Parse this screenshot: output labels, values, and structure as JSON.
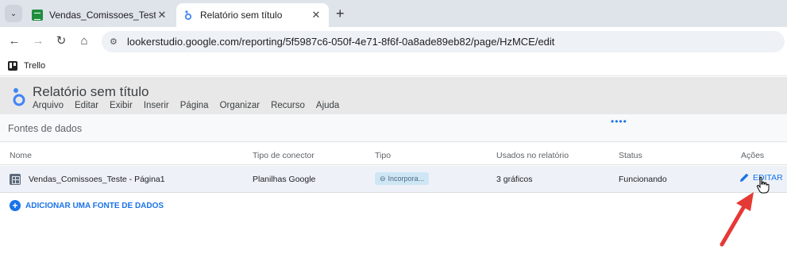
{
  "browser": {
    "tabs": [
      {
        "title": "Vendas_Comissoes_Teste - Plani",
        "icon": "sheets-icon",
        "active": false
      },
      {
        "title": "Relatório sem título",
        "icon": "looker-studio-icon",
        "active": true
      }
    ],
    "url": "lookerstudio.google.com/reporting/5f5987c6-050f-4e71-8f6f-0a8ade89eb82/page/HzMCE/edit",
    "bookmarks": [
      {
        "label": "Trello"
      }
    ]
  },
  "app": {
    "report_title": "Relatório sem título",
    "menu": [
      "Arquivo",
      "Editar",
      "Exibir",
      "Inserir",
      "Página",
      "Organizar",
      "Recurso",
      "Ajuda"
    ]
  },
  "data_sources": {
    "panel_title": "Fontes de dados",
    "columns": {
      "name": "Nome",
      "connector": "Tipo de conector",
      "type": "Tipo",
      "used": "Usados no relatório",
      "status": "Status",
      "actions": "Ações"
    },
    "rows": [
      {
        "name": "Vendas_Comissoes_Teste - Página1",
        "connector": "Planilhas Google",
        "type": "Incorpora...",
        "used": "3 gráficos",
        "status": "Funcionando",
        "action": "EDITAR"
      }
    ],
    "add_label": "ADICIONAR UMA FONTE DE DADOS"
  },
  "colors": {
    "accent": "#1a73e8",
    "annotation_arrow": "#e53935",
    "sheets_green": "#1e8e3e"
  }
}
